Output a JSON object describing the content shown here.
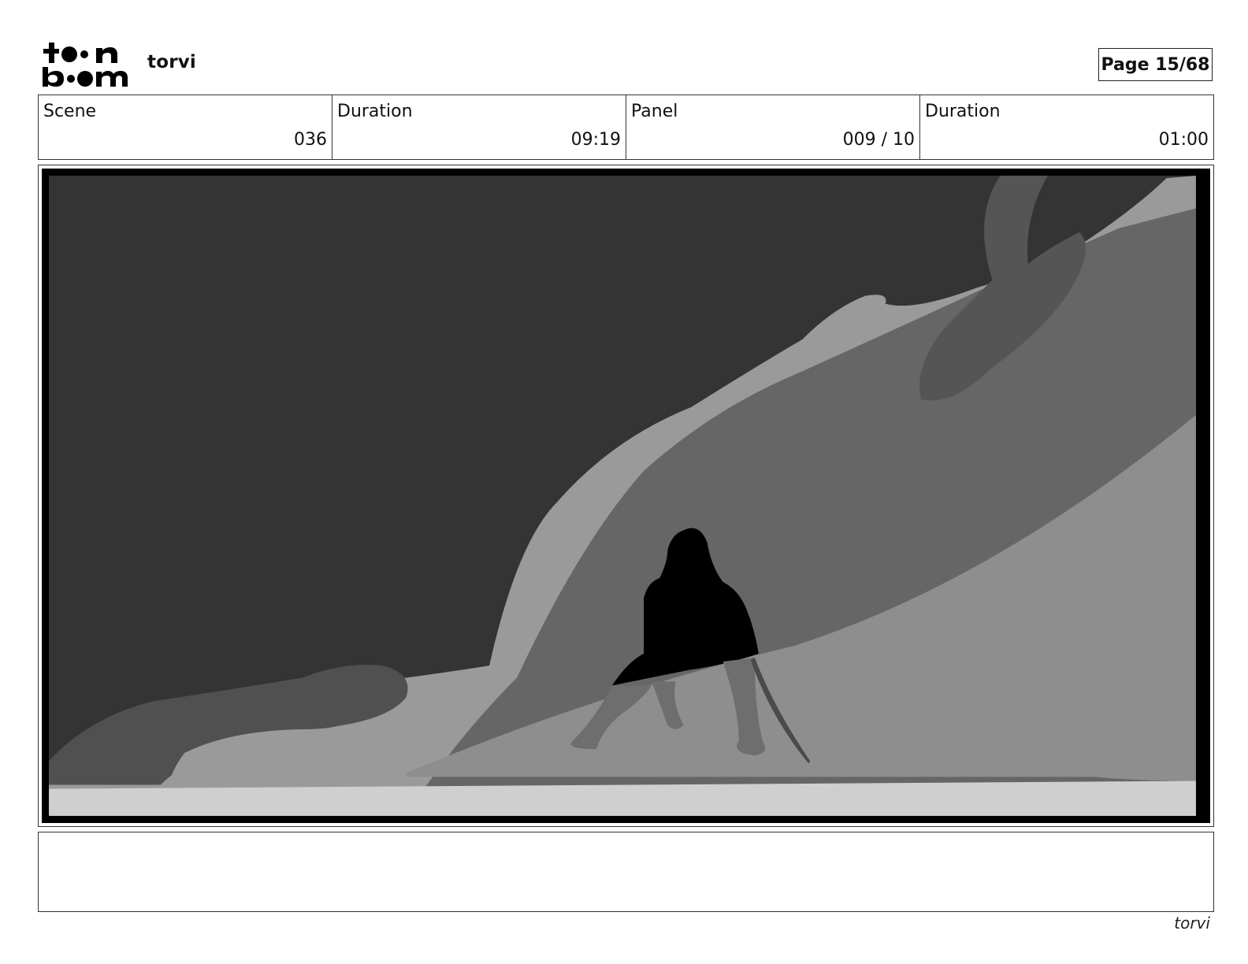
{
  "header": {
    "logo_text": "toon boom",
    "project_title": "torvi",
    "page_label": "Page 15/68"
  },
  "info": {
    "scene_label": "Scene",
    "scene_value": "036",
    "scene_duration_label": "Duration",
    "scene_duration_value": "09:19",
    "panel_label": "Panel",
    "panel_value": "009 / 10",
    "panel_duration_label": "Duration",
    "panel_duration_value": "01:00"
  },
  "notes": {
    "text": ""
  },
  "footer": {
    "project_name": "torvi"
  },
  "colors": {
    "sky": "#343434",
    "mid_light": "#9a9a9a",
    "mid_dark": "#666666",
    "ground": "#cfcfcf",
    "figure": "#000000"
  }
}
